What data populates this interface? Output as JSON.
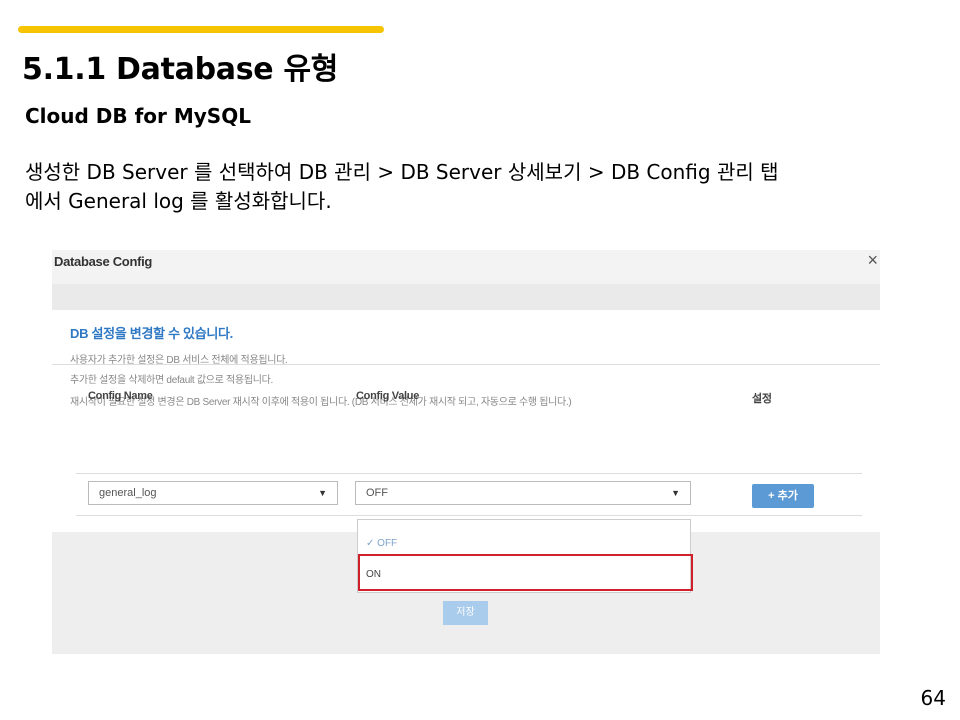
{
  "slide": {
    "title": "5.1.1 Database 유형",
    "subtitle": "Cloud DB for MySQL",
    "instruction_line1": "생성한 DB Server 를 선택하여 DB 관리 > DB Server 상세보기 > DB Config 관리 탭",
    "instruction_line2": "에서 General log 를 활성화합니다.",
    "page_number": "64",
    "accent_color": "#F6C400"
  },
  "dialog": {
    "title": "Database Config",
    "close_icon": "close-icon",
    "notice_title": "DB 설정을 변경할 수 있습니다.",
    "notice_lines": [
      "사용자가 추가한 설정은 DB 서비스 전체에 적용됩니다.",
      "추가한 설정을 삭제하면 default 값으로 적용됩니다.",
      "재시작이 필요한 설정 변경은 DB Server 재시작 이후에 적용이 됩니다. (DB 서비스 전체가 재시작 되고, 자동으로 수행 됩니다.)"
    ],
    "columns": [
      "Config Name",
      "Config Value",
      "설정"
    ],
    "config_name_value": "general_log",
    "config_value_value": "OFF",
    "add_button": "+ 추가",
    "dropdown_options": [
      "OFF",
      "ON"
    ],
    "dropdown_checked_icon": "check-icon",
    "highlight_color": "#d0202a",
    "save_button": "저장"
  }
}
